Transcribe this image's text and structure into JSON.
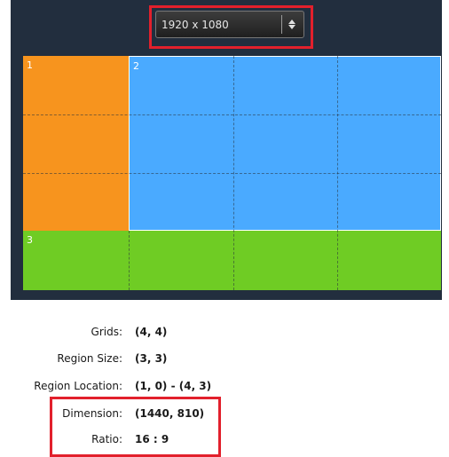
{
  "resolution_select": {
    "value": "1920 x 1080"
  },
  "regions": [
    {
      "id": "1",
      "color": "#f7941e"
    },
    {
      "id": "2",
      "color": "#4aaaff"
    },
    {
      "id": "3",
      "color": "#6fcc24"
    }
  ],
  "info": [
    {
      "label": "Grids:",
      "value": "(4, 4)"
    },
    {
      "label": "Region Size:",
      "value": "(3, 3)"
    },
    {
      "label": "Region Location:",
      "value": "(1, 0) - (4, 3)"
    },
    {
      "label": "Dimension:",
      "value": "(1440, 810)"
    },
    {
      "label": "Ratio:",
      "value": "16 : 9"
    }
  ],
  "colors": {
    "panel_background": "#222e3e",
    "highlight_border": "#e2202c"
  }
}
